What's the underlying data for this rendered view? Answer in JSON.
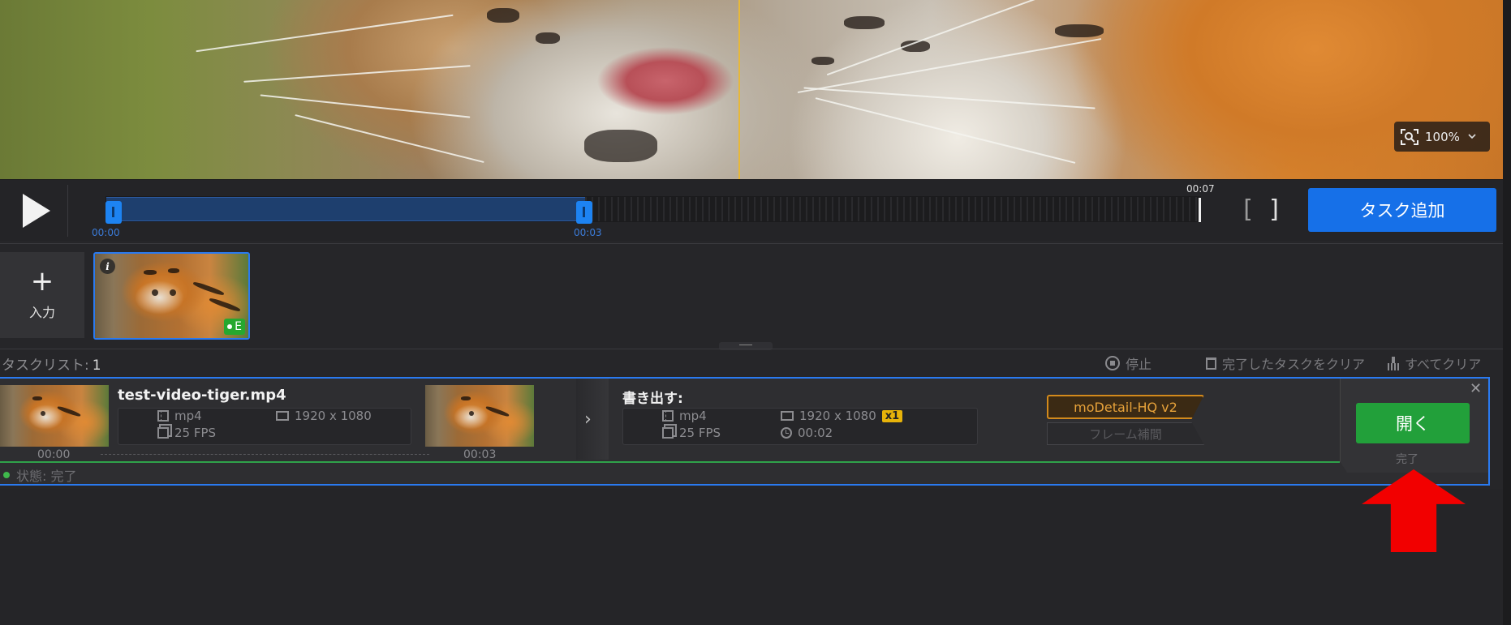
{
  "preview": {
    "zoom_label": "100%",
    "zoom_icon": "zoom-fit-icon",
    "dropdown_icon": "chevron-down-icon"
  },
  "timeline": {
    "start_time": "00:00",
    "mid_time": "00:03",
    "end_time": "00:07",
    "add_task_label": "タスク追加"
  },
  "media": {
    "input_label": "入力",
    "plus_glyph": "+",
    "info_glyph": "i",
    "badge_label": "E"
  },
  "tasklist": {
    "title": "タスクリスト:",
    "count": "1",
    "stop_label": "停止",
    "clear_done_label": "完了したタスクをクリア",
    "clear_all_label": "すべてクリア"
  },
  "task": {
    "filename": "test-video-tiger.mp4",
    "src": {
      "format": "mp4",
      "resolution": "1920 x 1080",
      "fps": "25 FPS",
      "start_time": "00:00",
      "end_time": "00:03"
    },
    "output": {
      "label": "書き出す:",
      "format": "mp4",
      "resolution": "1920 x 1080",
      "scale": "x1",
      "fps": "25 FPS",
      "duration": "00:02"
    },
    "model": "moDetail-HQ  v2",
    "interpolation": "フレーム補間",
    "open_label": "開く",
    "done_label": "完了",
    "close_glyph": "✕",
    "status_text": "状態: 完了",
    "chevron_glyph": "›"
  },
  "colors": {
    "accent_blue": "#1670e8",
    "open_green": "#22a03a",
    "model_orange": "#d38a1c",
    "annotation_red": "#f20000"
  }
}
